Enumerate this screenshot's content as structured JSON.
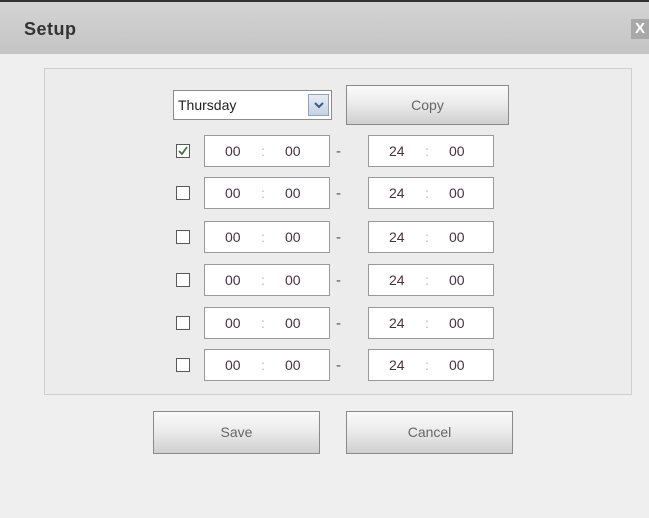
{
  "window": {
    "title": "Setup",
    "close_label": "X"
  },
  "day_select": {
    "value": "Thursday"
  },
  "copy_label": "Copy",
  "save_label": "Save",
  "cancel_label": "Cancel",
  "periods": [
    {
      "checked": true,
      "start": {
        "h": "00",
        "m": "00"
      },
      "end": {
        "h": "24",
        "m": "00"
      },
      "sep": ":",
      "dash": "-"
    },
    {
      "checked": false,
      "start": {
        "h": "00",
        "m": "00"
      },
      "end": {
        "h": "24",
        "m": "00"
      },
      "sep": ":",
      "dash": "-"
    },
    {
      "checked": false,
      "start": {
        "h": "00",
        "m": "00"
      },
      "end": {
        "h": "24",
        "m": "00"
      },
      "sep": ":",
      "dash": "-"
    },
    {
      "checked": false,
      "start": {
        "h": "00",
        "m": "00"
      },
      "end": {
        "h": "24",
        "m": "00"
      },
      "sep": ":",
      "dash": "-"
    },
    {
      "checked": false,
      "start": {
        "h": "00",
        "m": "00"
      },
      "end": {
        "h": "24",
        "m": "00"
      },
      "sep": ":",
      "dash": "-"
    },
    {
      "checked": false,
      "start": {
        "h": "00",
        "m": "00"
      },
      "end": {
        "h": "24",
        "m": "00"
      },
      "sep": ":",
      "dash": "-"
    }
  ],
  "colors": {
    "titlebar": "#c8c8c8",
    "panel_border": "#cfcfcf",
    "check_mark": "#3a7a3a"
  },
  "icons": {
    "dropdown": "chevron-down-icon",
    "checkbox_checked": "check-icon",
    "close": "close-icon"
  }
}
